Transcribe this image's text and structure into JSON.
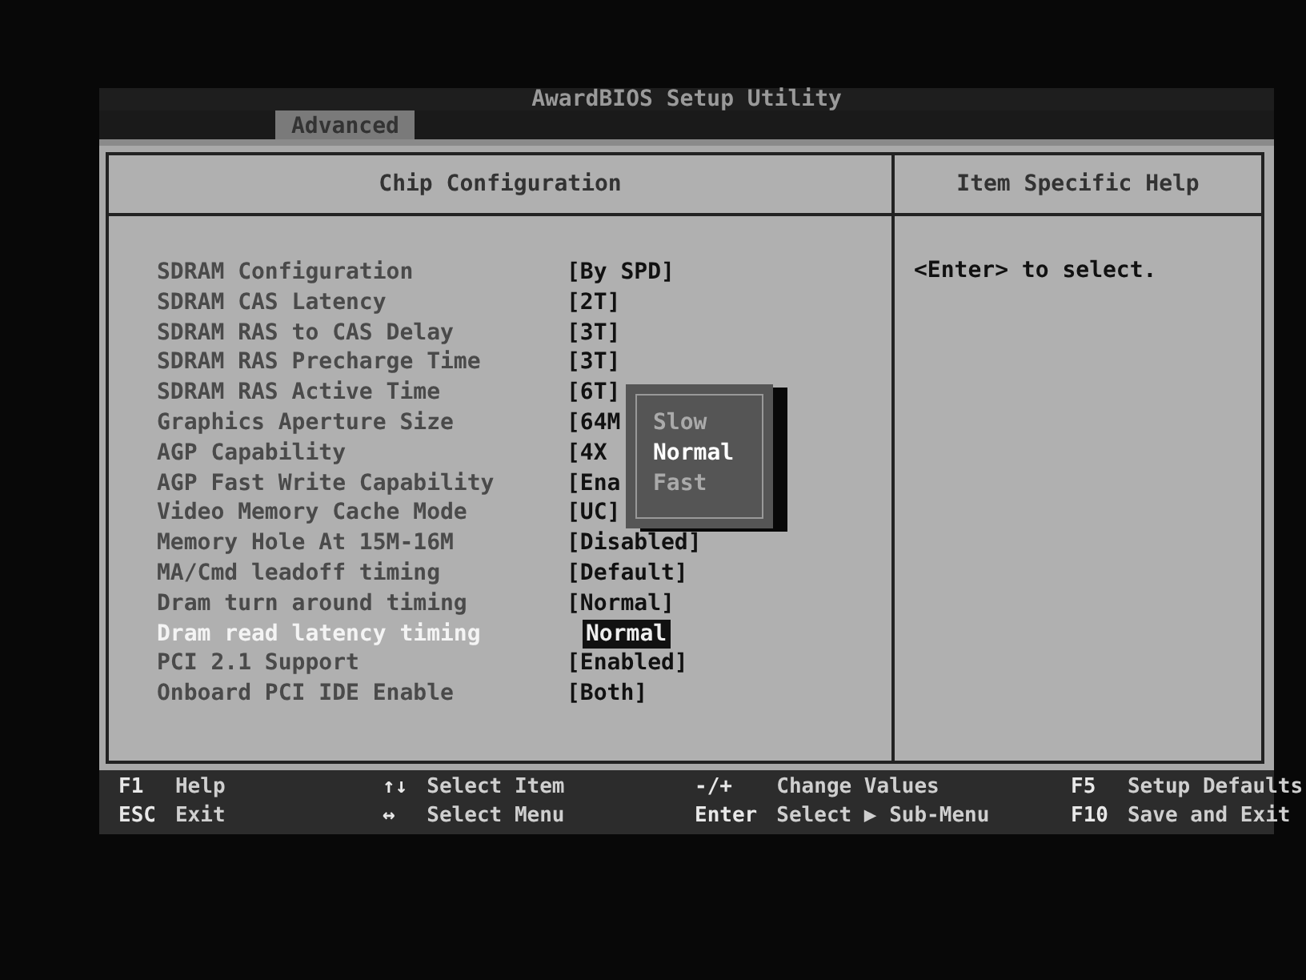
{
  "title": "AwardBIOS Setup Utility",
  "tabs": [
    {
      "label": "Advanced",
      "selected": true
    }
  ],
  "panel": {
    "title": "Chip Configuration",
    "settings": [
      {
        "label": "SDRAM Configuration",
        "value": "[By SPD]",
        "selected": false
      },
      {
        "label": "SDRAM CAS Latency",
        "value": "[2T]",
        "selected": false
      },
      {
        "label": "SDRAM RAS to CAS Delay",
        "value": "[3T]",
        "selected": false
      },
      {
        "label": "SDRAM RAS Precharge Time",
        "value": "[3T]",
        "selected": false
      },
      {
        "label": "SDRAM RAS Active Time",
        "value": "[6T]",
        "selected": false
      },
      {
        "label": "Graphics Aperture Size",
        "value": "[64M",
        "selected": false
      },
      {
        "label": "AGP Capability",
        "value": "[4X",
        "selected": false
      },
      {
        "label": "AGP Fast Write Capability",
        "value": "[Ena",
        "selected": false
      },
      {
        "label": "Video Memory Cache Mode",
        "value": "[UC]",
        "selected": false
      },
      {
        "label": "Memory Hole At 15M-16M",
        "value": "[Disabled]",
        "selected": false
      },
      {
        "label": "MA/Cmd leadoff timing",
        "value": "[Default]",
        "selected": false
      },
      {
        "label": "Dram turn around timing",
        "value": "[Normal]",
        "selected": false
      },
      {
        "label": "Dram read latency timing",
        "value": "Normal",
        "selected": true
      },
      {
        "label": "PCI 2.1 Support",
        "value": "[Enabled]",
        "selected": false
      },
      {
        "label": "Onboard PCI IDE Enable",
        "value": "[Both]",
        "selected": false
      }
    ],
    "popup": {
      "options": [
        {
          "label": "Slow",
          "selected": false
        },
        {
          "label": "Normal",
          "selected": true
        },
        {
          "label": "Fast",
          "selected": false
        }
      ]
    }
  },
  "help": {
    "title": "Item Specific Help",
    "text": "<Enter> to select."
  },
  "footer": [
    [
      {
        "key": "F1",
        "action": "Help"
      },
      {
        "key": "ESC",
        "action": "Exit"
      }
    ],
    [
      {
        "key": "↑↓",
        "action": "Select Item"
      },
      {
        "key": "↔",
        "action": "Select Menu"
      }
    ],
    [
      {
        "key": "-/+",
        "action": "Change Values"
      },
      {
        "key": "Enter",
        "action": "Select ▶ Sub-Menu"
      }
    ],
    [
      {
        "key": "F5",
        "action": "Setup Defaults"
      },
      {
        "key": "F10",
        "action": "Save and Exit"
      }
    ]
  ]
}
